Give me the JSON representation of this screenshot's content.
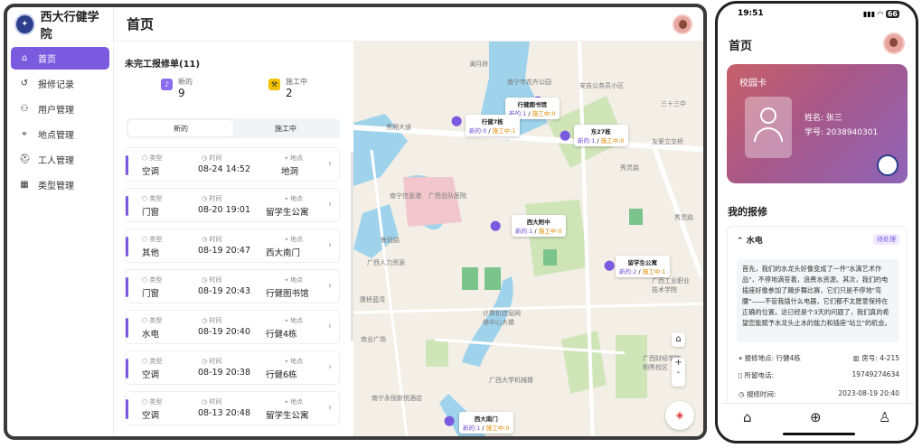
{
  "app": {
    "name": "西大行健学院",
    "page_title": "首页"
  },
  "sidebar": {
    "items": [
      {
        "label": "首页",
        "icon": "home-icon",
        "active": true
      },
      {
        "label": "报修记录",
        "icon": "history-icon"
      },
      {
        "label": "用户管理",
        "icon": "users-icon"
      },
      {
        "label": "地点管理",
        "icon": "location-icon"
      },
      {
        "label": "工人管理",
        "icon": "worker-icon"
      },
      {
        "label": "类型管理",
        "icon": "table-icon"
      }
    ]
  },
  "orders": {
    "title": "未完工报修单(11)",
    "stats": [
      {
        "label": "新的",
        "value": "9",
        "color": "#8b6cf0"
      },
      {
        "label": "施工中",
        "value": "2",
        "color": "#f2c200"
      }
    ],
    "tabs": [
      "新的",
      "施工中"
    ],
    "field_labels": {
      "type": "类型",
      "time": "时间",
      "place": "地点"
    },
    "items": [
      {
        "type": "空调",
        "time": "08-24 14:52",
        "place": "地洞"
      },
      {
        "type": "门窗",
        "time": "08-20 19:01",
        "place": "留学生公寓"
      },
      {
        "type": "其他",
        "time": "08-19 20:47",
        "place": "西大南门"
      },
      {
        "type": "门窗",
        "time": "08-19 20:43",
        "place": "行健图书馆"
      },
      {
        "type": "水电",
        "time": "08-19 20:40",
        "place": "行健4栋"
      },
      {
        "type": "空调",
        "time": "08-19 20:38",
        "place": "行健6栋"
      },
      {
        "type": "空调",
        "time": "08-13 20:48",
        "place": "留学生公寓"
      }
    ]
  },
  "map": {
    "labels": [
      "澜月府",
      "南宁市花卉公园",
      "安吉公务员小区",
      "三十三中",
      "秀厢大道",
      "友爱立交桥",
      "秀灵路",
      "南宁信息港",
      "广西总队医院",
      "鲁班路",
      "广西人力资源",
      "康桥蓝湾",
      "计算机信息网络中心大楼",
      "商业广场",
      "广西工业职业技术学院",
      "广西财经学院明秀校区",
      "广西大学机械楼",
      "南宁永恒新悦酒店",
      "西大南门",
      "秀灵路"
    ],
    "markers": [
      {
        "name": "行健图书馆",
        "new": "新的:1",
        "working": "施工中:0"
      },
      {
        "name": "行健7栋",
        "new": "新的:0",
        "working": "施工中:1"
      },
      {
        "name": "东27栋",
        "new": "新的:1",
        "working": "施工中:0"
      },
      {
        "name": "西大附中",
        "new": "新的:1",
        "working": "施工中:0"
      },
      {
        "name": "留学生公寓",
        "new": "新的:2",
        "working": "施工中:1"
      },
      {
        "name": "西大南门",
        "new": "新的:1",
        "working": "施工中:0"
      }
    ],
    "sep": "/",
    "zoom_in": "+",
    "zoom_out": "-"
  },
  "phone": {
    "status_time": "19:51",
    "battery": "66",
    "title": "首页",
    "card": {
      "title": "校园卡",
      "name_label": "姓名:",
      "name": "张三",
      "id_label": "学号:",
      "id": "2038940301"
    },
    "section": "我的报修",
    "repair": {
      "type": "水电",
      "status": "待处理",
      "description": "首先，我们的水龙头好像变成了一件\"水滴艺术作品\"，不停地滴答着，浪费水资源。其次，我们的电插座好像参加了踢步舞比赛，它们只是不停地\"弯腰\"——不管我插什么电器，它们都不太愿意保持在正确的位置。这已经是个3天的问题了，我们真的希望您能赋予水龙头止水的能力和插座\"站立\"的机会。",
      "rows": [
        {
          "label": "报修地点: 行健4栋",
          "value": "房号: 4-215"
        },
        {
          "label": "所留电话:",
          "value": "19749274634"
        },
        {
          "label": "报修时间:",
          "value": "2023-08-19 20:40"
        }
      ]
    }
  },
  "colors": {
    "accent": "#7a5be0",
    "warn": "#f2c200"
  }
}
